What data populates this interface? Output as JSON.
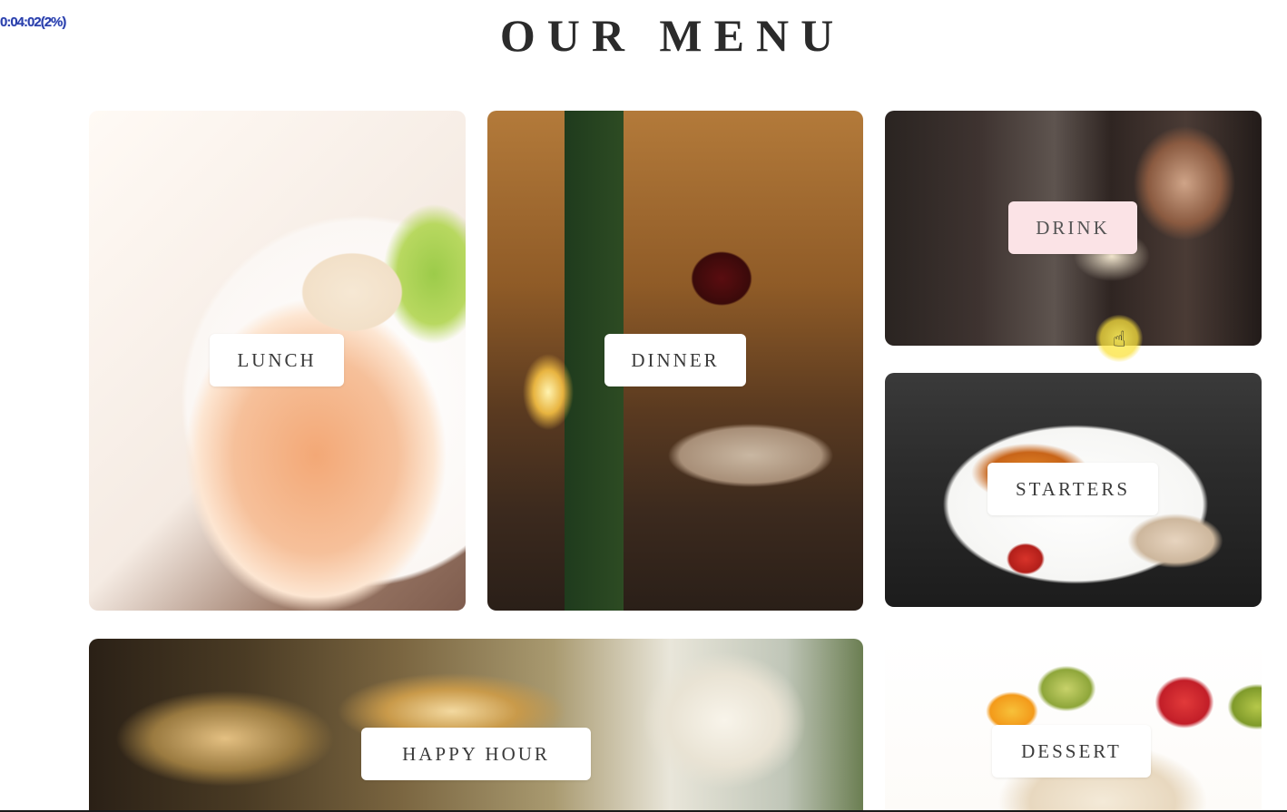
{
  "recording": {
    "timer": "0:04:02(2%)"
  },
  "section": {
    "title": "OUR MENU"
  },
  "menu_cards": {
    "lunch": {
      "label": "LUNCH"
    },
    "dinner": {
      "label": "DINNER"
    },
    "drink": {
      "label": "DRINK"
    },
    "starters": {
      "label": "STARTERS"
    },
    "happy_hour": {
      "label": "HAPPY HOUR"
    },
    "dessert": {
      "label": "DESSERT"
    }
  },
  "cursor": {
    "icon": "hand-pointer-icon",
    "highlight_color": "#f7e23c"
  }
}
